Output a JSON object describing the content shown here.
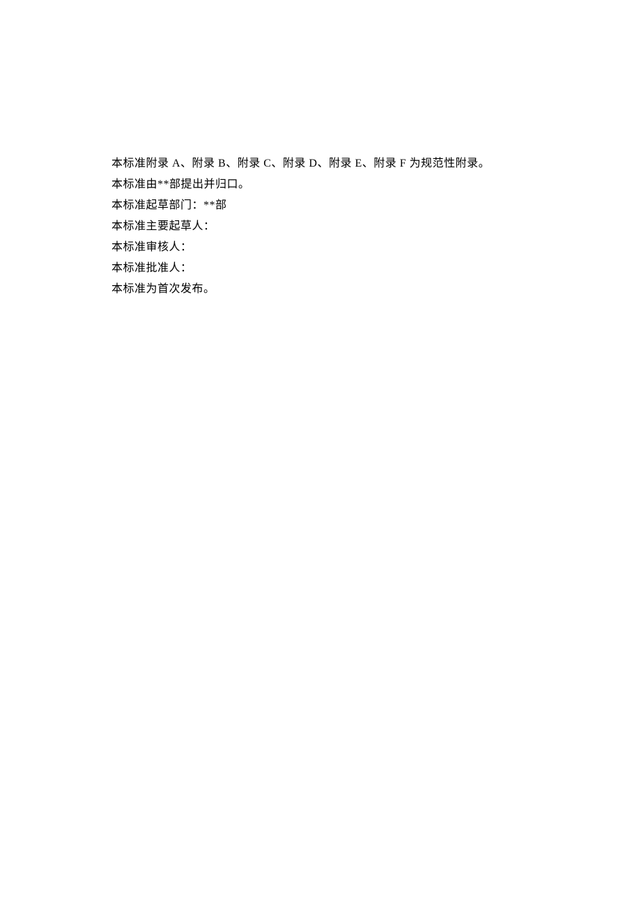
{
  "lines": [
    "本标准附录 A、附录 B、附录 C、附录 D、附录 E、附录 F 为规范性附录。",
    "本标准由**部提出并归口。",
    "本标准起草部门：**部",
    "本标准主要起草人：",
    "本标准审核人：",
    "本标准批准人：",
    "本标准为首次发布。"
  ]
}
